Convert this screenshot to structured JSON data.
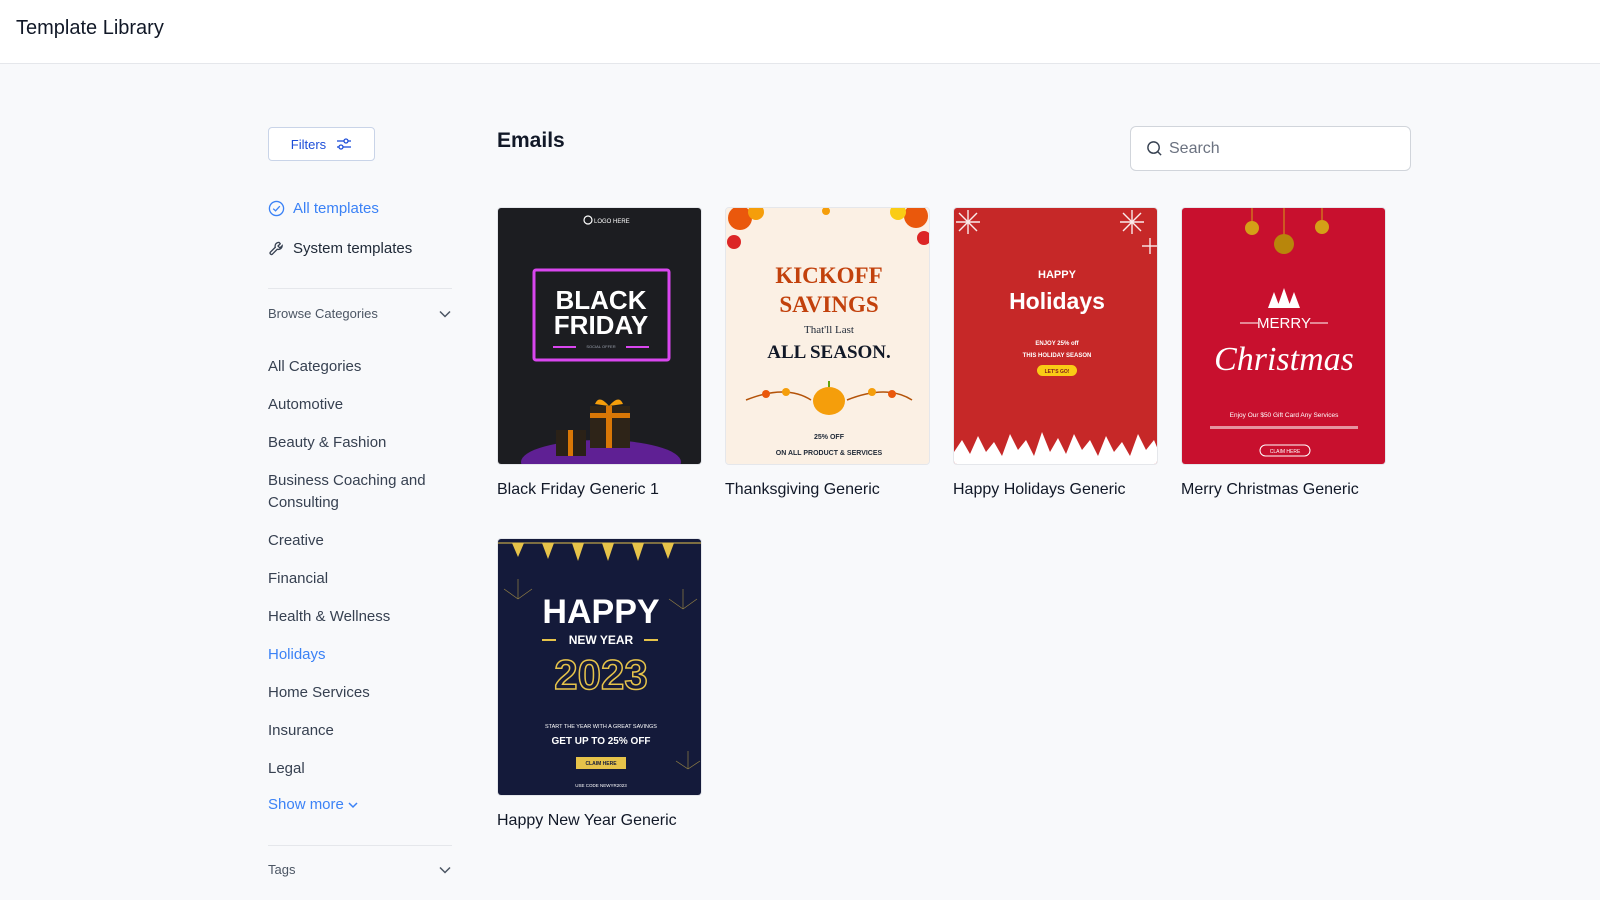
{
  "header": {
    "title": "Template Library"
  },
  "filters": {
    "label": "Filters"
  },
  "scopes": [
    {
      "label": "All templates",
      "active": true
    },
    {
      "label": "System templates",
      "active": false
    }
  ],
  "browse": {
    "label": "Browse Categories"
  },
  "categories": [
    {
      "label": "All Categories",
      "active": false
    },
    {
      "label": "Automotive",
      "active": false
    },
    {
      "label": "Beauty & Fashion",
      "active": false
    },
    {
      "label": "Business Coaching and Consulting",
      "active": false
    },
    {
      "label": "Creative",
      "active": false
    },
    {
      "label": "Financial",
      "active": false
    },
    {
      "label": "Health & Wellness",
      "active": false
    },
    {
      "label": "Holidays",
      "active": true
    },
    {
      "label": "Home Services",
      "active": false
    },
    {
      "label": "Insurance",
      "active": false
    },
    {
      "label": "Legal",
      "active": false
    }
  ],
  "show_more": "Show more",
  "tags": {
    "label": "Tags"
  },
  "main": {
    "title": "Emails"
  },
  "search": {
    "placeholder": "Search",
    "value": ""
  },
  "templates": [
    {
      "name": "Black Friday Generic 1",
      "thumb_texts": [
        "LOGO HERE",
        "BLACK",
        "FRIDAY",
        "SOCIAL OFFER"
      ]
    },
    {
      "name": "Thanksgiving Generic",
      "thumb_texts": [
        "KICKOFF",
        "SAVINGS",
        "That'll Last",
        "ALL SEASON.",
        "25% OFF",
        "ON ALL PRODUCT & SERVICES"
      ]
    },
    {
      "name": "Happy Holidays Generic",
      "thumb_texts": [
        "HAPPY",
        "Holidays",
        "ENJOY 25% off",
        "THIS HOLIDAY SEASON",
        "LET'S GO!"
      ]
    },
    {
      "name": "Merry Christmas Generic",
      "thumb_texts": [
        "MERRY",
        "Christmas",
        "Enjoy Our $50 Gift Card Any Services",
        "CLAIM HERE"
      ]
    },
    {
      "name": "Happy New Year Generic",
      "thumb_texts": [
        "HAPPY",
        "NEW YEAR",
        "2023",
        "START THE YEAR WITH A GREAT SAVINGS",
        "GET UP TO 25% OFF",
        "CLAIM HERE",
        "USE CODE NEWYR2023"
      ]
    }
  ],
  "colors": {
    "accent": "#3b82f6",
    "black_friday_bg": "#1c1d21",
    "black_friday_neon": "#d946ef",
    "thanksgiving_bg": "#fbf0e4",
    "thanksgiving_title": "#c2410c",
    "holidays_red": "#c62828",
    "christmas_red": "#c8102e",
    "new_year_navy": "#141a3a",
    "gold": "#e6c34a"
  }
}
